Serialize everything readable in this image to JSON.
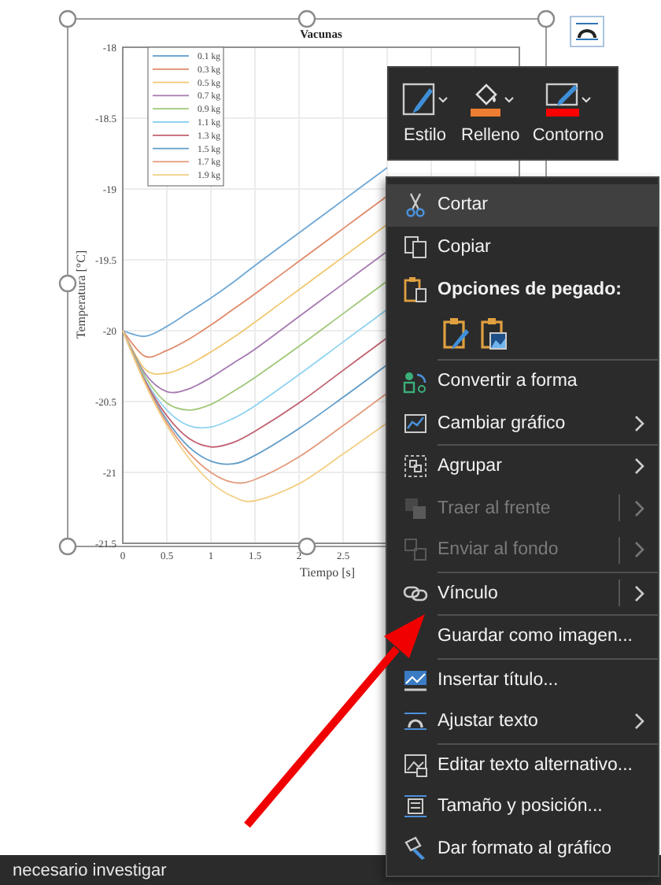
{
  "chart": {
    "chart_data": {
      "type": "line",
      "title": "Vacunas",
      "xlabel": "Tiempo [s]",
      "ylabel": "Temperatura [°C]",
      "x": [
        0,
        0.25,
        0.5,
        0.75,
        1,
        1.25,
        1.5,
        2,
        2.5,
        3
      ],
      "xlim": [
        0,
        4.5
      ],
      "ylim": [
        -21.5,
        -18
      ],
      "xticks": [
        0,
        0.5,
        1,
        1.5,
        2,
        2.5
      ],
      "yticks": [
        -21.5,
        -21,
        -20.5,
        -20,
        -19.5,
        -19,
        -18.5,
        -18
      ],
      "grid": true,
      "legend": true,
      "series": [
        {
          "name": "0.1 kg",
          "color": "#6fa8d6",
          "values": [
            -20,
            -20.04,
            -19.97,
            -19.87,
            -19.77,
            -19.66,
            -19.54,
            -19.31,
            -19.08,
            -18.85
          ]
        },
        {
          "name": "0.3 kg",
          "color": "#e08a6a",
          "values": [
            -20,
            -20.18,
            -20.14,
            -20.06,
            -19.96,
            -19.85,
            -19.74,
            -19.51,
            -19.28,
            -19.05
          ]
        },
        {
          "name": "0.5 kg",
          "color": "#f0c870",
          "values": [
            -20,
            -20.27,
            -20.3,
            -20.24,
            -20.15,
            -20.05,
            -19.94,
            -19.71,
            -19.48,
            -19.25
          ]
        },
        {
          "name": "0.7 kg",
          "color": "#a57ab0",
          "values": [
            -20,
            -20.3,
            -20.43,
            -20.41,
            -20.33,
            -20.23,
            -20.13,
            -19.9,
            -19.67,
            -19.44
          ]
        },
        {
          "name": "0.9 kg",
          "color": "#a0c878",
          "values": [
            -20,
            -20.32,
            -20.51,
            -20.56,
            -20.52,
            -20.43,
            -20.33,
            -20.11,
            -19.88,
            -19.65
          ]
        },
        {
          "name": "1.1 kg",
          "color": "#8fd3f0",
          "values": [
            -20,
            -20.34,
            -20.56,
            -20.67,
            -20.68,
            -20.62,
            -20.53,
            -20.31,
            -20.08,
            -19.85
          ]
        },
        {
          "name": "1.3 kg",
          "color": "#c06070",
          "values": [
            -20,
            -20.35,
            -20.6,
            -20.76,
            -20.82,
            -20.79,
            -20.71,
            -20.51,
            -20.28,
            -20.05
          ]
        },
        {
          "name": "1.5 kg",
          "color": "#5f9cc9",
          "values": [
            -20,
            -20.36,
            -20.63,
            -20.82,
            -20.92,
            -20.94,
            -20.88,
            -20.69,
            -20.47,
            -20.24
          ]
        },
        {
          "name": "1.7 kg",
          "color": "#e39a7c",
          "values": [
            -20,
            -20.36,
            -20.65,
            -20.86,
            -21,
            -21.07,
            -21.05,
            -20.89,
            -20.67,
            -20.44
          ]
        },
        {
          "name": "1.9 kg",
          "color": "#f2cf85",
          "values": [
            -20,
            -20.37,
            -20.67,
            -20.9,
            -21.07,
            -21.17,
            -21.2,
            -21.08,
            -20.87,
            -20.65
          ]
        }
      ]
    }
  },
  "mini_toolbar": {
    "buttons": [
      {
        "kind": "style",
        "label": "Estilo"
      },
      {
        "kind": "fill",
        "label": "Relleno"
      },
      {
        "kind": "outline",
        "label": "Contorno"
      }
    ]
  },
  "context_menu": {
    "items": [
      {
        "kind": "command",
        "label": "Cortar",
        "selected": true,
        "disabled": false,
        "submenu": false,
        "split": false,
        "separator_before": false
      },
      {
        "kind": "command",
        "label": "Copiar",
        "selected": false,
        "disabled": false,
        "submenu": false,
        "split": false,
        "separator_before": false
      },
      {
        "kind": "header",
        "label": "Opciones de pegado:"
      },
      {
        "kind": "paste_options"
      },
      {
        "kind": "command",
        "label": "Convertir a forma",
        "selected": false,
        "disabled": false,
        "submenu": false,
        "split": false,
        "separator_before": true
      },
      {
        "kind": "command",
        "label": "Cambiar gráfico",
        "selected": false,
        "disabled": false,
        "submenu": true,
        "split": false,
        "separator_before": false
      },
      {
        "kind": "command",
        "label": "Agrupar",
        "selected": false,
        "disabled": false,
        "submenu": true,
        "split": false,
        "separator_before": true
      },
      {
        "kind": "command",
        "label": "Traer al frente",
        "selected": false,
        "disabled": true,
        "submenu": true,
        "split": true,
        "separator_before": false
      },
      {
        "kind": "command",
        "label": "Enviar al fondo",
        "selected": false,
        "disabled": true,
        "submenu": true,
        "split": true,
        "separator_before": false
      },
      {
        "kind": "command",
        "label": "Vínculo",
        "selected": false,
        "disabled": false,
        "submenu": true,
        "split": true,
        "separator_before": true
      },
      {
        "kind": "command",
        "label": "Guardar como imagen...",
        "selected": false,
        "disabled": false,
        "submenu": false,
        "split": false,
        "separator_before": true
      },
      {
        "kind": "command",
        "label": "Insertar título...",
        "selected": false,
        "disabled": false,
        "submenu": false,
        "split": false,
        "separator_before": true
      },
      {
        "kind": "command",
        "label": "Ajustar texto",
        "selected": false,
        "disabled": false,
        "submenu": true,
        "split": false,
        "separator_before": false
      },
      {
        "kind": "command",
        "label": "Editar texto alternativo...",
        "selected": false,
        "disabled": false,
        "submenu": false,
        "split": false,
        "separator_before": true
      },
      {
        "kind": "command",
        "label": "Tamaño y posición...",
        "selected": false,
        "disabled": false,
        "submenu": false,
        "split": false,
        "separator_before": false
      },
      {
        "kind": "command",
        "label": "Dar formato al gráfico",
        "selected": false,
        "disabled": false,
        "submenu": false,
        "split": false,
        "separator_before": false
      }
    ]
  },
  "status_bar": {
    "text": "necesario investigar"
  }
}
